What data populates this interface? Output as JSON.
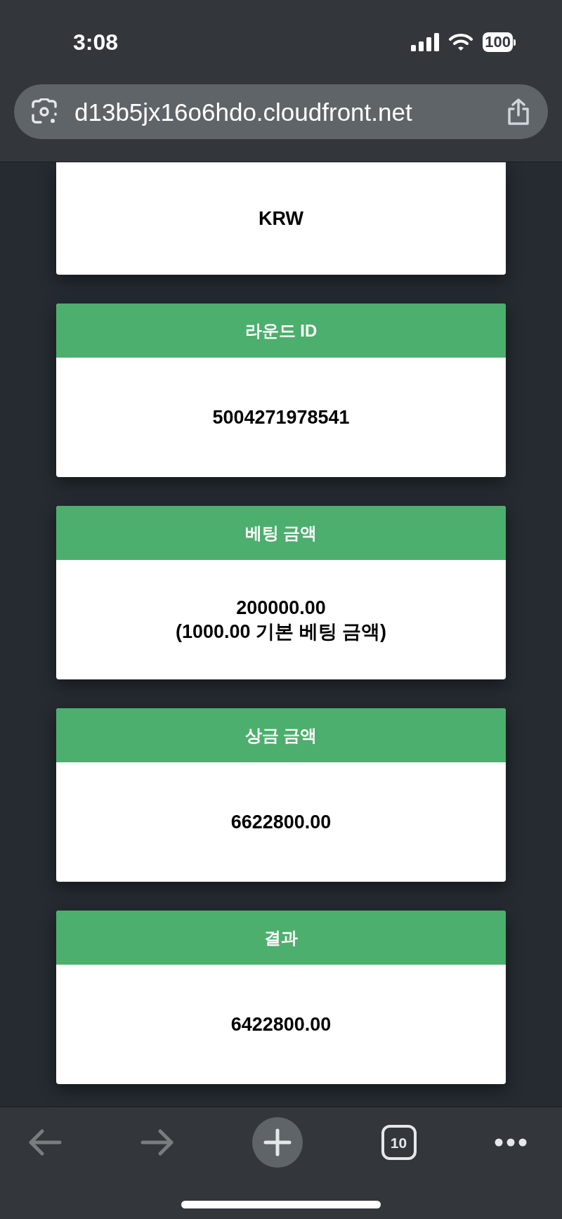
{
  "status_bar": {
    "time": "3:08",
    "battery": "100"
  },
  "address_bar": {
    "url": "d13b5jx16o6hdo.cloudfront.net"
  },
  "cards": [
    {
      "lines": [
        "KRW"
      ]
    },
    {
      "header": "라운드 ID",
      "lines": [
        "5004271978541"
      ]
    },
    {
      "header": "베팅 금액",
      "lines": [
        "200000.00",
        "(1000.00 기본 베팅 금액)"
      ]
    },
    {
      "header": "상금 금액",
      "lines": [
        "6622800.00"
      ]
    },
    {
      "header": "결과",
      "lines": [
        "6422800.00"
      ]
    }
  ],
  "toolbar": {
    "back_disabled": true,
    "forward_disabled": true,
    "tab_count": "10"
  }
}
